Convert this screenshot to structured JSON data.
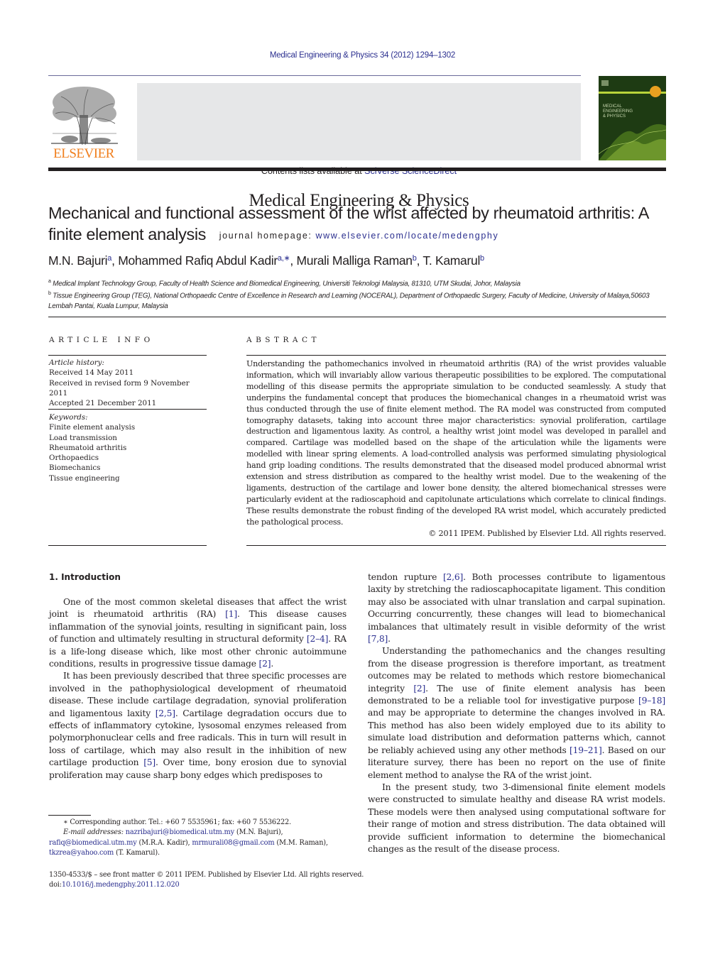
{
  "header": {
    "journal_ref": "Medical Engineering & Physics 34 (2012) 1294–1302",
    "contents_prefix": "Contents lists available at ",
    "contents_link": "SciVerse ScienceDirect",
    "journal_title": "Medical Engineering & Physics",
    "homepage_prefix": "journal homepage: ",
    "homepage_link": "www.elsevier.com/locate/medengphy",
    "publisher_logo_text": "ELSEVIER",
    "colors": {
      "publisher_orange": "#f07f1e",
      "link_blue": "#2b2f8f",
      "banner_gray": "#e6e7e8",
      "cover_green": "#1e3b13"
    }
  },
  "article": {
    "title": "Mechanical and functional assessment of the wrist affected by rheumatoid arthritis: A finite element analysis",
    "authors": [
      {
        "name": "M.N. Bajuri",
        "sup": "a",
        "sep": ", "
      },
      {
        "name": "Mohammed Rafiq Abdul Kadir",
        "sup": "a,∗",
        "sep": ", "
      },
      {
        "name": "Murali Malliga Raman",
        "sup": "b",
        "sep": ", "
      },
      {
        "name": "T. Kamarul",
        "sup": "b",
        "sep": ""
      }
    ],
    "affiliations": [
      {
        "sup": "a",
        "text": "Medical Implant Technology Group, Faculty of Health Science and Biomedical Engineering, Universiti Teknologi Malaysia, 81310, UTM Skudai, Johor, Malaysia"
      },
      {
        "sup": "b",
        "text": "Tissue Engineering Group (TEG), National Orthopaedic Centre of Excellence in Research and Learning (NOCERAL), Department of Orthopaedic Surgery, Faculty of Medicine, University of Malaya,50603 Lembah Pantai, Kuala Lumpur, Malaysia"
      }
    ]
  },
  "article_info": {
    "heading": "ARTICLE INFO",
    "history_label": "Article history:",
    "history": [
      "Received 14 May 2011",
      "Received in revised form 9 November 2011",
      "Accepted 21 December 2011"
    ],
    "keywords_label": "Keywords:",
    "keywords": [
      "Finite element analysis",
      "Load transmission",
      "Rheumatoid arthritis",
      "Orthopaedics",
      "Biomechanics",
      "Tissue engineering"
    ]
  },
  "abstract": {
    "heading": "ABSTRACT",
    "body": "Understanding the pathomechanics involved in rheumatoid arthritis (RA) of the wrist provides valuable information, which will invariably allow various therapeutic possibilities to be explored. The computational modelling of this disease permits the appropriate simulation to be conducted seamlessly. A study that underpins the fundamental concept that produces the biomechanical changes in a rheumatoid wrist was thus conducted through the use of finite element method. The RA model was constructed from computed tomography datasets, taking into account three major characteristics: synovial proliferation, cartilage destruction and ligamentous laxity. As control, a healthy wrist joint model was developed in parallel and compared. Cartilage was modelled based on the shape of the articulation while the ligaments were modelled with linear spring elements. A load-controlled analysis was performed simulating physiological hand grip loading conditions. The results demonstrated that the diseased model produced abnormal wrist extension and stress distribution as compared to the healthy wrist model. Due to the weakening of the ligaments, destruction of the cartilage and lower bone density, the altered biomechanical stresses were particularly evident at the radioscaphoid and capitolunate articulations which correlate to clinical findings. These results demonstrate the robust finding of the developed RA wrist model, which accurately predicted the pathological process.",
    "copyright": "© 2011 IPEM. Published by Elsevier Ltd. All rights reserved."
  },
  "introduction": {
    "heading": "1.  Introduction",
    "paragraphs": [
      [
        {
          "t": "One of the most common skeletal diseases that affect the wrist joint is rheumatoid arthritis (RA) "
        },
        {
          "c": "[1]"
        },
        {
          "t": ". This disease causes inflammation of the synovial joints, resulting in significant pain, loss of function and ultimately resulting in structural deformity "
        },
        {
          "c": "[2–4]"
        },
        {
          "t": ". RA is a life-long disease which, like most other chronic autoimmune conditions, results in progressive tissue damage "
        },
        {
          "c": "[2]"
        },
        {
          "t": "."
        }
      ],
      [
        {
          "t": "It has been previously described that three specific processes are involved in the pathophysiological development of rheumatoid disease. These include cartilage degradation, synovial proliferation and ligamentous laxity "
        },
        {
          "c": "[2,5]"
        },
        {
          "t": ". Cartilage degradation occurs due to effects of inflammatory cytokine, lysosomal enzymes released from polymorphonuclear cells and free radicals. This in turn will result in loss of cartilage, which may also result in the inhibition of new cartilage production "
        },
        {
          "c": "[5]"
        },
        {
          "t": ". Over time, bony erosion due to synovial proliferation may cause sharp bony edges which predisposes to"
        }
      ]
    ],
    "right_paragraphs": [
      [
        {
          "t": "tendon rupture "
        },
        {
          "c": "[2,6]"
        },
        {
          "t": ". Both processes contribute to ligamentous laxity by stretching the radioscaphocapitate ligament. This condition may also be associated with ulnar translation and carpal supination. Occurring concurrently, these changes will lead to biomechanical imbalances that ultimately result in visible deformity of the wrist "
        },
        {
          "c": "[7,8]"
        },
        {
          "t": "."
        }
      ],
      [
        {
          "t": "Understanding the pathomechanics and the changes resulting from the disease progression is therefore important, as treatment outcomes may be related to methods which restore biomechanical integrity "
        },
        {
          "c": "[2]"
        },
        {
          "t": ". The use of finite element analysis has been demonstrated to be a reliable tool for investigative purpose "
        },
        {
          "c": "[9–18]"
        },
        {
          "t": " and may be appropriate to determine the changes involved in RA. This method has also been widely employed due to its ability to simulate load distribution and deformation patterns which, cannot be reliably achieved using any other methods "
        },
        {
          "c": "[19–21]"
        },
        {
          "t": ". Based on our literature survey, there has been no report on the use of finite element method to analyse the RA of the wrist joint."
        }
      ],
      [
        {
          "t": "In the present study, two 3-dimensional finite element models were constructed to simulate healthy and disease RA wrist models. These models were then analysed using computational software for their range of motion and stress distribution. The data obtained will provide sufficient information to determine the biomechanical changes as the result of the disease process."
        }
      ]
    ]
  },
  "footnotes": {
    "corresponding": "∗  Corresponding author. Tel.: +60 7 5535961; fax: +60 7 5536222.",
    "email_label": "E-mail addresses:",
    "emails": [
      {
        "email": "nazribajuri@biomedical.utm.my",
        "who": " (M.N. Bajuri),",
        "sep": " "
      },
      {
        "email": "rafiq@biomedical.utm.my",
        "who": " (M.R.A. Kadir), ",
        "sep": ""
      },
      {
        "email": "mrmurali08@gmail.com",
        "who": " (M.M. Raman),",
        "sep": " "
      },
      {
        "email": "tkzrea@yahoo.com",
        "who": " (T. Kamarul).",
        "sep": ""
      }
    ],
    "front_matter": "1350-4533/$ – see front matter © 2011 IPEM. Published by Elsevier Ltd. All rights reserved.",
    "doi_prefix": "doi:",
    "doi": "10.1016/j.medengphy.2011.12.020"
  }
}
